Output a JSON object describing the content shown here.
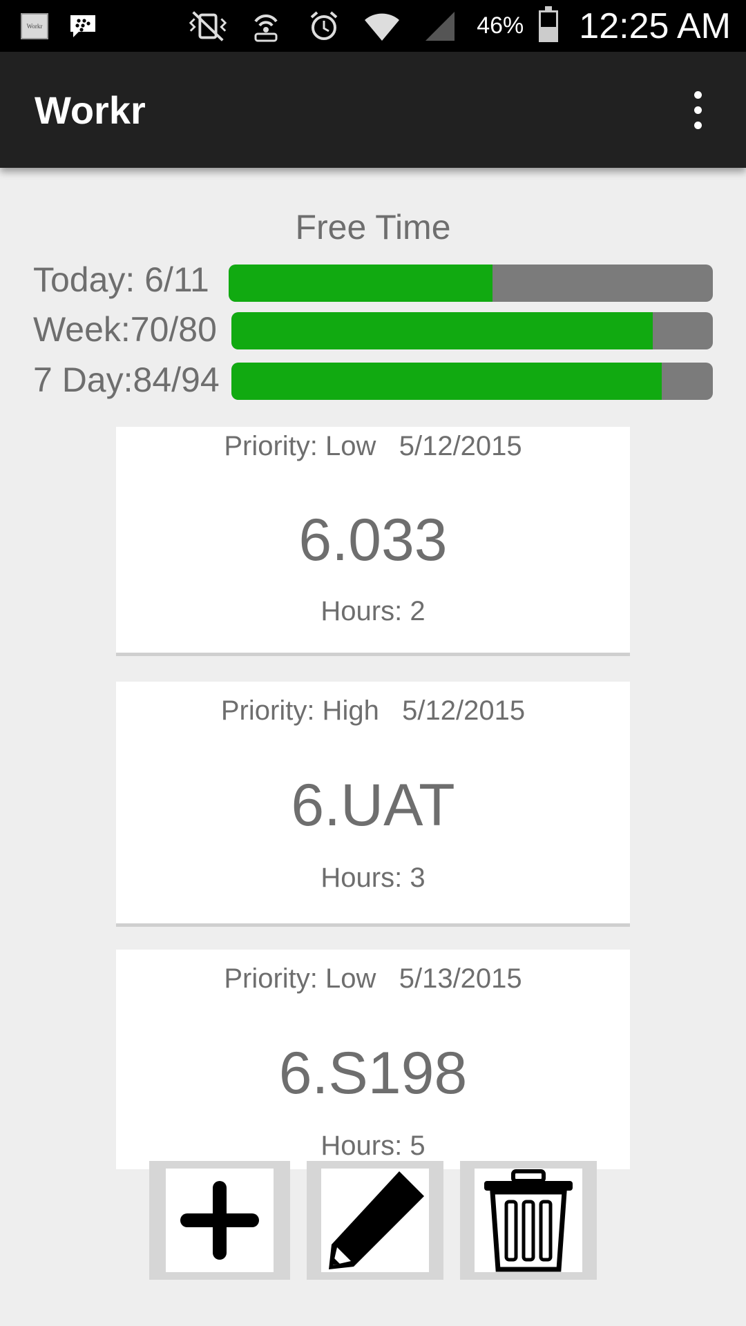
{
  "status_bar": {
    "app_icon_text": "Workr",
    "battery_percent": "46%",
    "time": "12:25 AM"
  },
  "app_bar": {
    "title": "Workr"
  },
  "free_time": {
    "heading": "Free Time",
    "bars": [
      {
        "label": "Today: 6/11",
        "fraction": 0.545
      },
      {
        "label": "Week:70/80",
        "fraction": 0.875
      },
      {
        "label": "7 Day:84/94",
        "fraction": 0.894
      }
    ]
  },
  "tasks": [
    {
      "priority": "Priority: Low",
      "date": "5/12/2015",
      "name": "6.033",
      "hours": "Hours: 2"
    },
    {
      "priority": "Priority: High",
      "date": "5/12/2015",
      "name": "6.UAT",
      "hours": "Hours: 3"
    },
    {
      "priority": "Priority: Low",
      "date": "5/13/2015",
      "name": "6.S198",
      "hours": "Hours: 5"
    }
  ],
  "actions": [
    {
      "name": "add",
      "icon": "plus-icon"
    },
    {
      "name": "edit",
      "icon": "pencil-icon"
    },
    {
      "name": "delete",
      "icon": "trash-icon"
    }
  ],
  "colors": {
    "progress_fill": "#11aa11",
    "progress_track": "#7b7b7b",
    "app_bar": "#212121",
    "background": "#eeeeee"
  }
}
